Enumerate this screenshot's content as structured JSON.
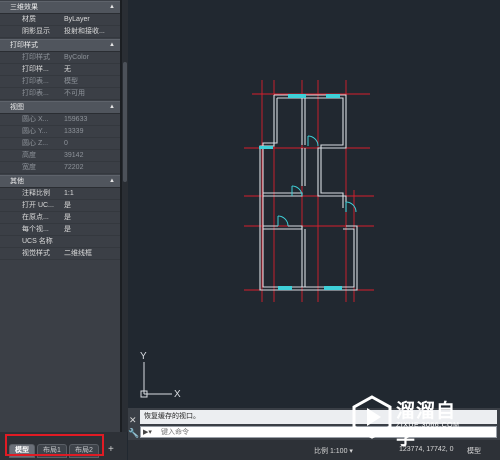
{
  "properties": {
    "sections": [
      {
        "title": "三维效果",
        "rows": [
          {
            "label": "材质",
            "value": "ByLayer",
            "readonly": false
          },
          {
            "label": "阴影显示",
            "value": "投射和接收...",
            "readonly": false
          }
        ]
      },
      {
        "title": "打印样式",
        "rows": [
          {
            "label": "打印样式",
            "value": "ByColor",
            "readonly": true
          },
          {
            "label": "打印样...",
            "value": "无",
            "readonly": false
          },
          {
            "label": "打印表...",
            "value": "模型",
            "readonly": true
          },
          {
            "label": "打印表...",
            "value": "不可用",
            "readonly": true
          }
        ]
      },
      {
        "title": "视图",
        "rows": [
          {
            "label": "圆心 X...",
            "value": "159633",
            "readonly": true
          },
          {
            "label": "圆心 Y...",
            "value": "13339",
            "readonly": true
          },
          {
            "label": "圆心 Z...",
            "value": "0",
            "readonly": true
          },
          {
            "label": "高度",
            "value": "39142",
            "readonly": true
          },
          {
            "label": "宽度",
            "value": "72202",
            "readonly": true
          }
        ]
      },
      {
        "title": "其他",
        "rows": [
          {
            "label": "注释比例",
            "value": "1:1",
            "readonly": false
          },
          {
            "label": "打开 UC...",
            "value": "是",
            "readonly": false
          },
          {
            "label": "在原点...",
            "value": "是",
            "readonly": false
          },
          {
            "label": "每个视...",
            "value": "是",
            "readonly": false
          },
          {
            "label": "UCS 名称",
            "value": "",
            "readonly": false
          },
          {
            "label": "视觉样式",
            "value": "二维线框",
            "readonly": false
          }
        ]
      }
    ]
  },
  "tabs": [
    {
      "label": "模型",
      "active": true
    },
    {
      "label": "布局1",
      "active": false
    },
    {
      "label": "布局2",
      "active": false
    }
  ],
  "tab_add_symbol": "+",
  "ucs": {
    "x_label": "X",
    "y_label": "Y"
  },
  "command": {
    "history": "恢复缓存的视口。",
    "placeholder": "键入命令",
    "close_symbol": "✕",
    "wrench_symbol": "🔧",
    "prompt_symbol": "▶▾"
  },
  "status": {
    "scale": "比例 1:100 ▾",
    "coords": "123774, 17742, 0",
    "model": "模型"
  },
  "watermark": {
    "title": "溜溜自学",
    "subtitle": "ZIXUE.3066.COM"
  },
  "colors": {
    "wall": "#d9dde2",
    "axis": "#d81e2c",
    "door": "#3fd0d8",
    "highlight": "#e01b24",
    "canvas_bg": "#212830"
  }
}
